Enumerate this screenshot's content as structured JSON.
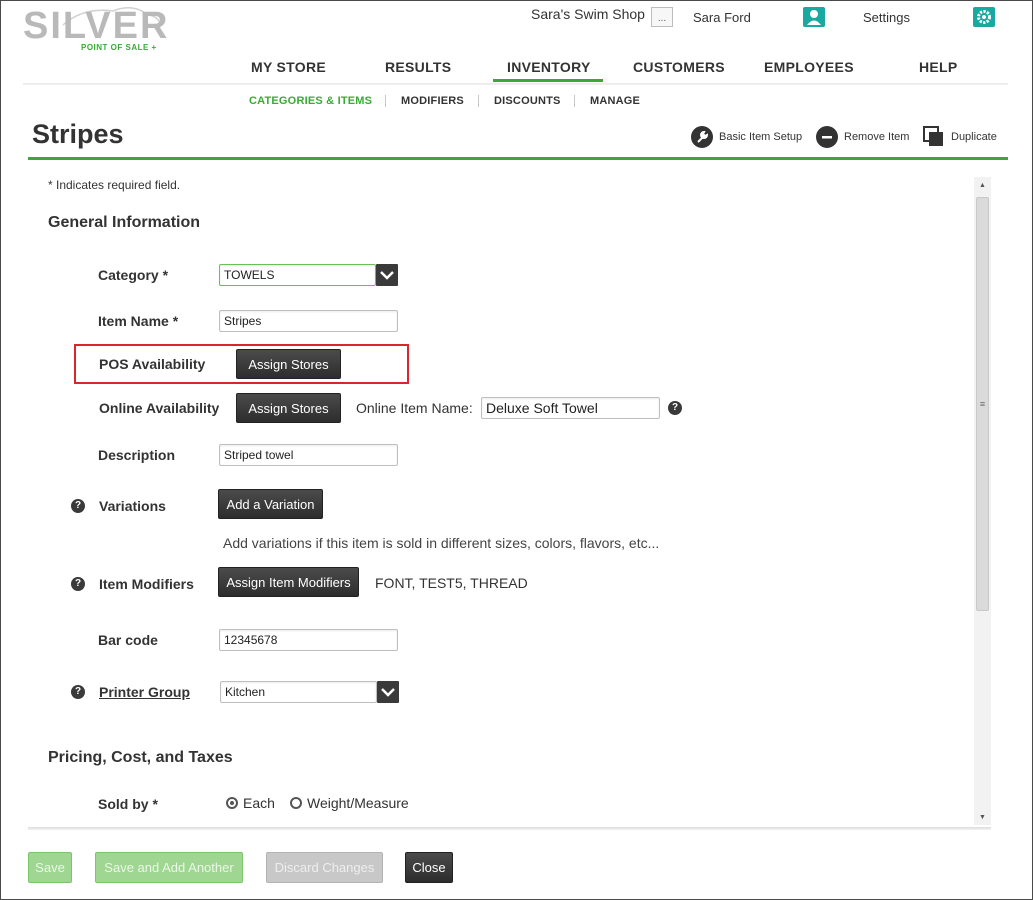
{
  "app": {
    "logo_text": "SILVER",
    "logo_subtext": "POINT OF SALE +"
  },
  "topbar": {
    "store_name": "Sara's Swim Shop",
    "store_more_label": "...",
    "user_name": "Sara Ford",
    "settings_label": "Settings"
  },
  "main_nav": {
    "items": [
      {
        "label": "MY STORE"
      },
      {
        "label": "RESULTS"
      },
      {
        "label": "INVENTORY",
        "active": true
      },
      {
        "label": "CUSTOMERS"
      },
      {
        "label": "EMPLOYEES"
      },
      {
        "label": "HELP"
      }
    ]
  },
  "sub_nav": {
    "items": [
      {
        "label": "CATEGORIES & ITEMS",
        "active": true
      },
      {
        "label": "MODIFIERS"
      },
      {
        "label": "DISCOUNTS"
      },
      {
        "label": "MANAGE"
      }
    ]
  },
  "page": {
    "title": "Stripes",
    "actions": {
      "basic_setup": "Basic Item Setup",
      "remove": "Remove Item",
      "duplicate": "Duplicate"
    }
  },
  "form": {
    "required_note": "* Indicates required field.",
    "general_title": "General Information",
    "category": {
      "label": "Category *",
      "value": "TOWELS"
    },
    "item_name": {
      "label": "Item Name *",
      "value": "Stripes"
    },
    "pos_availability": {
      "label": "POS Availability",
      "button": "Assign Stores"
    },
    "online_availability": {
      "label": "Online Availability",
      "button": "Assign Stores",
      "online_name_label": "Online Item Name:",
      "online_name_value": "Deluxe Soft Towel"
    },
    "description": {
      "label": "Description",
      "value": "Striped towel"
    },
    "variations": {
      "label": "Variations",
      "button": "Add a Variation",
      "hint": "Add variations if this item is sold in different sizes, colors, flavors, etc..."
    },
    "item_modifiers": {
      "label": "Item Modifiers",
      "button": "Assign Item Modifiers",
      "value": "FONT, TEST5, THREAD"
    },
    "bar_code": {
      "label": "Bar code",
      "value": "12345678"
    },
    "printer_group": {
      "label": "Printer Group",
      "value": "Kitchen"
    },
    "pricing_title": "Pricing, Cost, and Taxes",
    "sold_by": {
      "label": "Sold by *",
      "options": [
        {
          "label": "Each",
          "selected": true
        },
        {
          "label": "Weight/Measure",
          "selected": false
        }
      ]
    }
  },
  "footer": {
    "save": "Save",
    "save_add": "Save and Add Another",
    "discard": "Discard Changes",
    "close": "Close"
  },
  "colors": {
    "accent_green": "#3aa935",
    "teal": "#1aa9a0",
    "highlight_red": "#d9262c",
    "dark_button": "#333333"
  }
}
